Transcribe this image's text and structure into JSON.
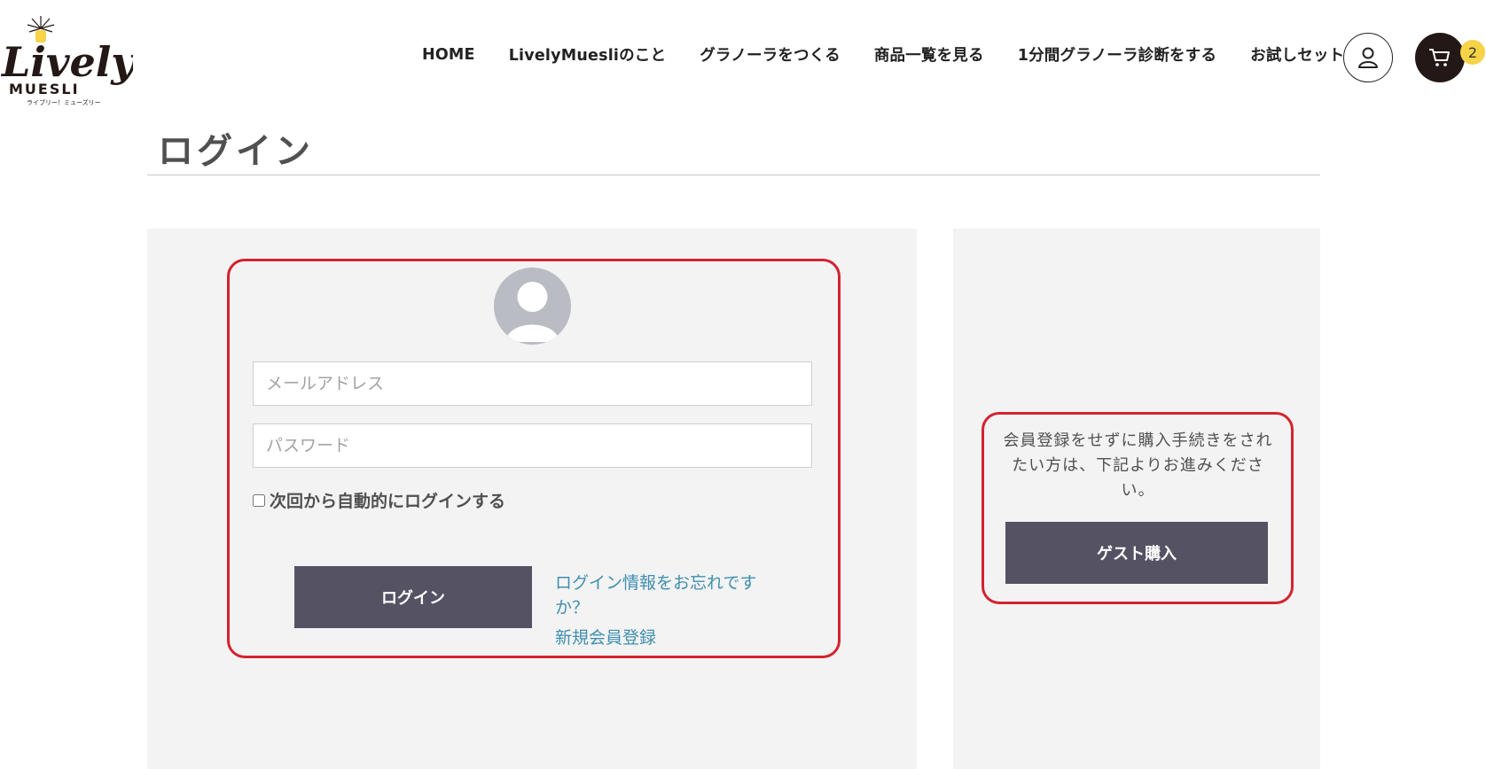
{
  "brand": {
    "logo_text": "Lively!",
    "logo_subtext": "MUESLI",
    "logo_kana": "ライブリー！ミューズリー"
  },
  "nav": {
    "items": [
      {
        "label": "HOME"
      },
      {
        "label": "LivelyMuesliのこと"
      },
      {
        "label": "グラノーラをつくる"
      },
      {
        "label": "商品一覧を見る"
      },
      {
        "label": "1分間グラノーラ診断をする"
      },
      {
        "label": "お試しセット"
      }
    ]
  },
  "header": {
    "user_icon": "user-icon",
    "cart_icon": "cart-icon",
    "cart_count": "2"
  },
  "page": {
    "title": "ログイン"
  },
  "login": {
    "avatar_icon": "avatar-icon",
    "email_placeholder": "メールアドレス",
    "password_placeholder": "パスワード",
    "remember_label": "次回から自動的にログインする",
    "submit_label": "ログイン",
    "forgot_link": "ログイン情報をお忘れですか？",
    "signup_link": "新規会員登録"
  },
  "guest": {
    "message": "会員登録をせずに購入手続きをされたい方は、下記よりお進みください。",
    "button_label": "ゲスト購入"
  },
  "colors": {
    "highlight_border": "#d3232f",
    "button_bg": "#545263",
    "panel_bg": "#f3f3f3",
    "link": "#3f8fb0",
    "cart_badge": "#f6d347",
    "cart_bg": "#231815"
  }
}
